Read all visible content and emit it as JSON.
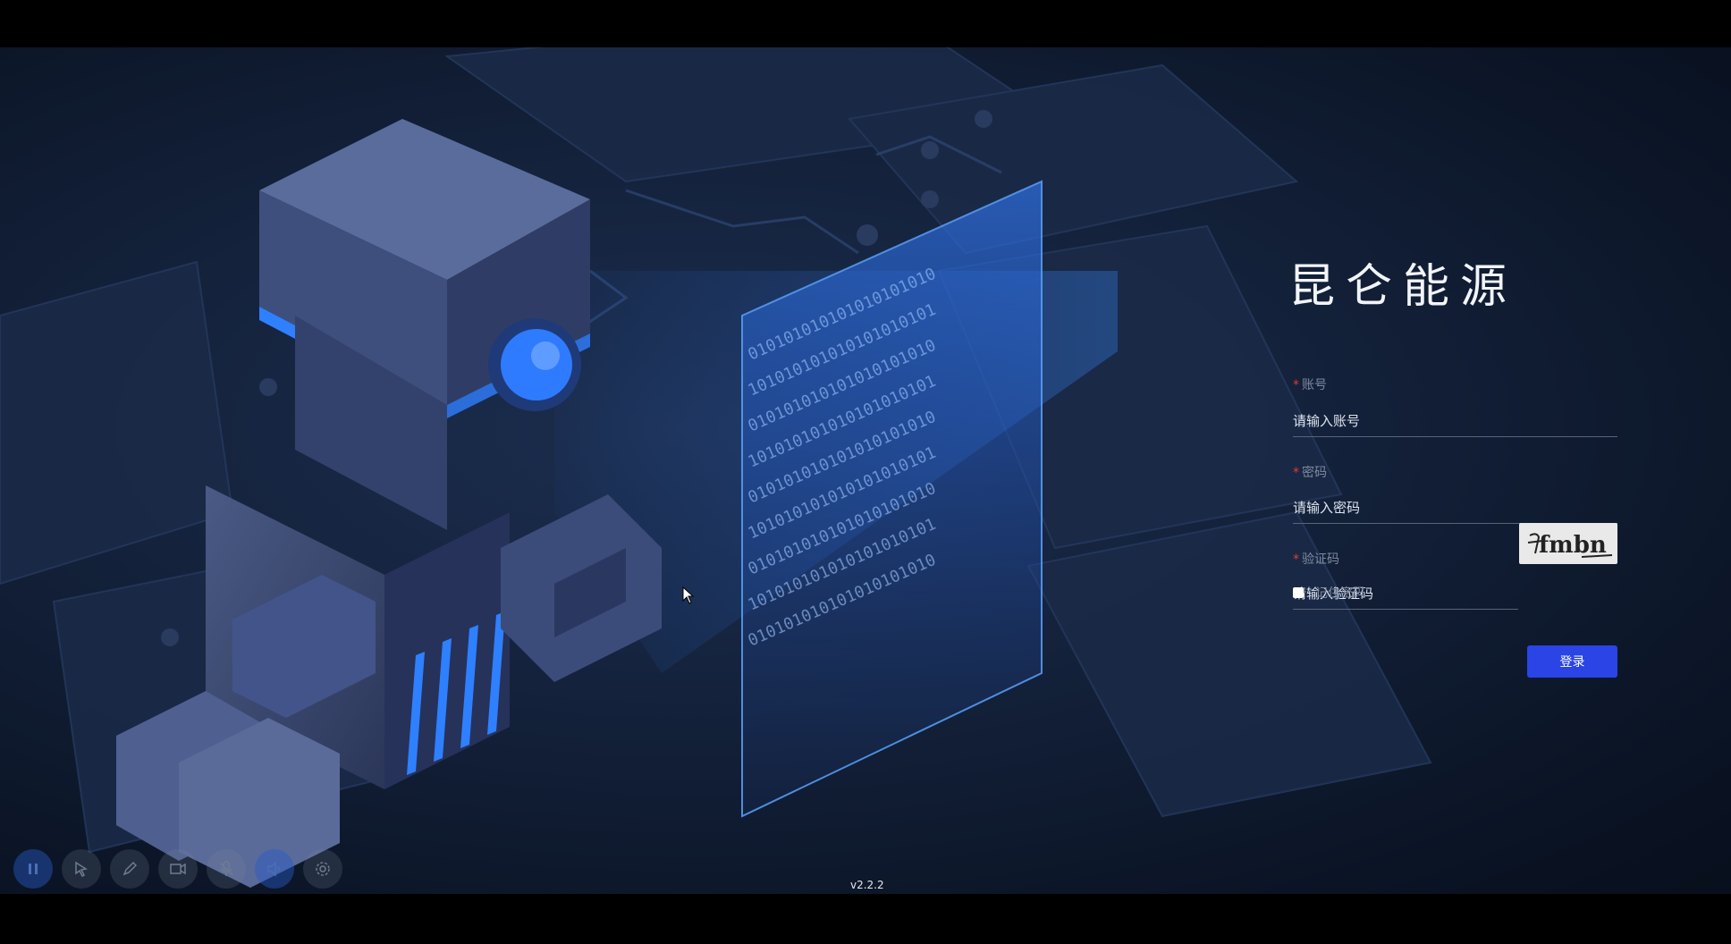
{
  "brand": {
    "title": "昆仑能源"
  },
  "form": {
    "account": {
      "label": "账号",
      "required_mark": "*",
      "placeholder": "请输入账号"
    },
    "password": {
      "label": "密码",
      "required_mark": "*",
      "placeholder": "请输入密码"
    },
    "captcha": {
      "label": "验证码",
      "required_mark": "*",
      "placeholder": "请输入验证码",
      "image_text": "fmbn"
    },
    "remember": {
      "label": "记住密码"
    },
    "submit_label": "登录"
  },
  "footer": {
    "version": "v2.2.2"
  },
  "toolbar": {
    "icons": [
      "pause-icon",
      "pointer-icon",
      "pen-icon",
      "camera-icon",
      "mic-off-icon",
      "speaker-icon",
      "gear-icon"
    ]
  },
  "colors": {
    "accent": "#2a44e6",
    "required": "#e53935",
    "glow": "#2f7bff"
  }
}
